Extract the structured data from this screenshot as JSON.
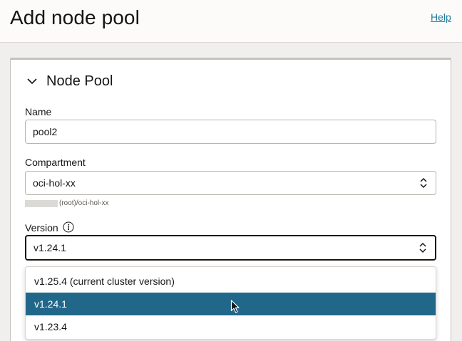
{
  "header": {
    "title": "Add node pool",
    "help_label": "Help"
  },
  "section": {
    "title": "Node Pool",
    "chevron_icon": "chevron-down-icon"
  },
  "name_field": {
    "label": "Name",
    "value": "pool2"
  },
  "compartment_field": {
    "label": "Compartment",
    "value": "oci-hol-xx",
    "hint": "(root)/oci-hol-xx"
  },
  "version_field": {
    "label": "Version",
    "value": "v1.24.1",
    "info_icon": "info-icon"
  },
  "version_options": [
    {
      "label": "v1.25.4 (current cluster version)"
    },
    {
      "label": "v1.24.1"
    },
    {
      "label": "v1.23.4"
    }
  ],
  "selected_option": "v1.24.1",
  "colors": {
    "selected_bg": "#21678a",
    "link": "#227e9e",
    "text": "#161513",
    "page_bg": "#f1efed"
  }
}
